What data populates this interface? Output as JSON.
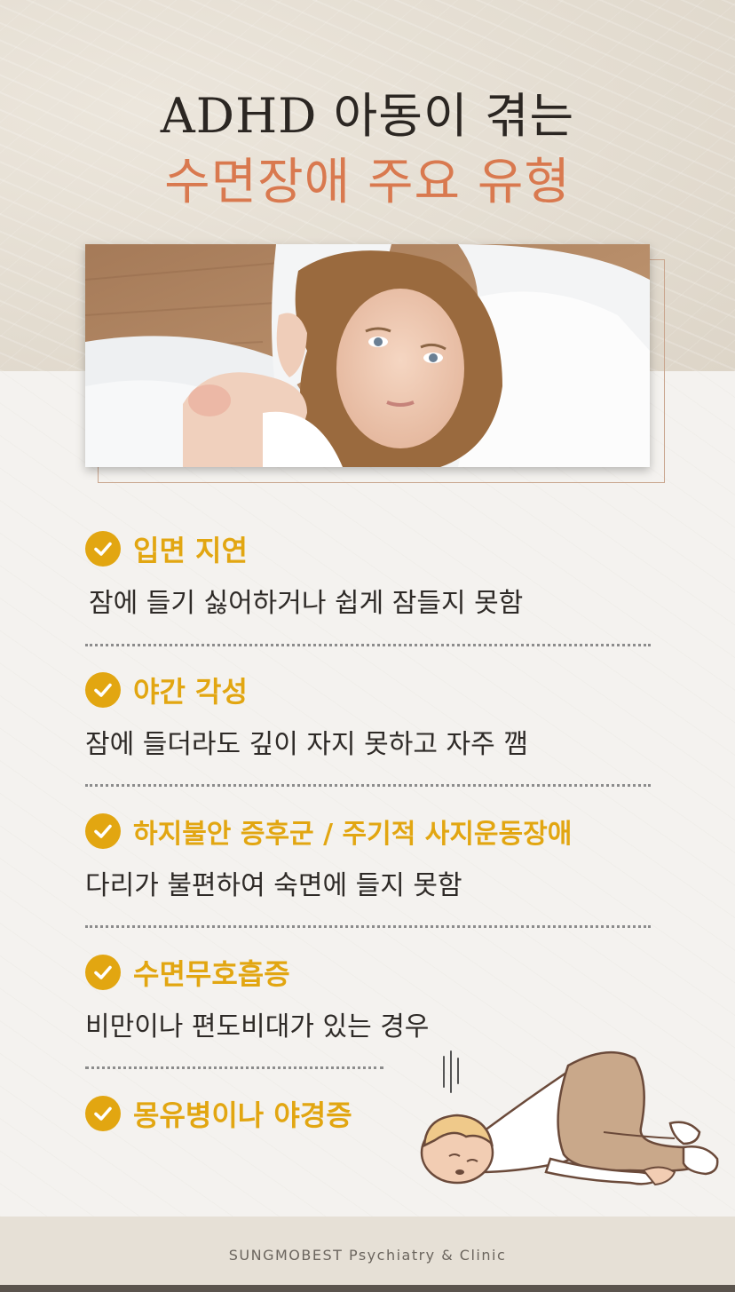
{
  "header": {
    "title_line1": "ADHD 아동이 겪는",
    "title_line2": "수면장애 주요 유형"
  },
  "hero_image": {
    "description_icon": "girl-covering-ears-with-pillow"
  },
  "items": [
    {
      "title": "입면 지연",
      "desc": "잠에 들기 싫어하거나 쉽게 잠들지 못함"
    },
    {
      "title": "야간 각성",
      "desc": "잠에 들더라도 깊이 자지 못하고 자주 깸"
    },
    {
      "title": "하지불안 증후군 / 주기적 사지운동장애",
      "desc": "다리가 불편하여 숙면에 들지 못함"
    },
    {
      "title": "수면무호흡증",
      "desc": "비만이나 편도비대가 있는 경우"
    },
    {
      "title": "몽유병이나 야경증",
      "desc": ""
    }
  ],
  "footer": {
    "text": "SUNGMOBEST Psychiatry & Clinic"
  },
  "colors": {
    "accent_gold": "#e2a611",
    "title_orange": "#d9794f",
    "text_dark": "#2e2a27"
  }
}
